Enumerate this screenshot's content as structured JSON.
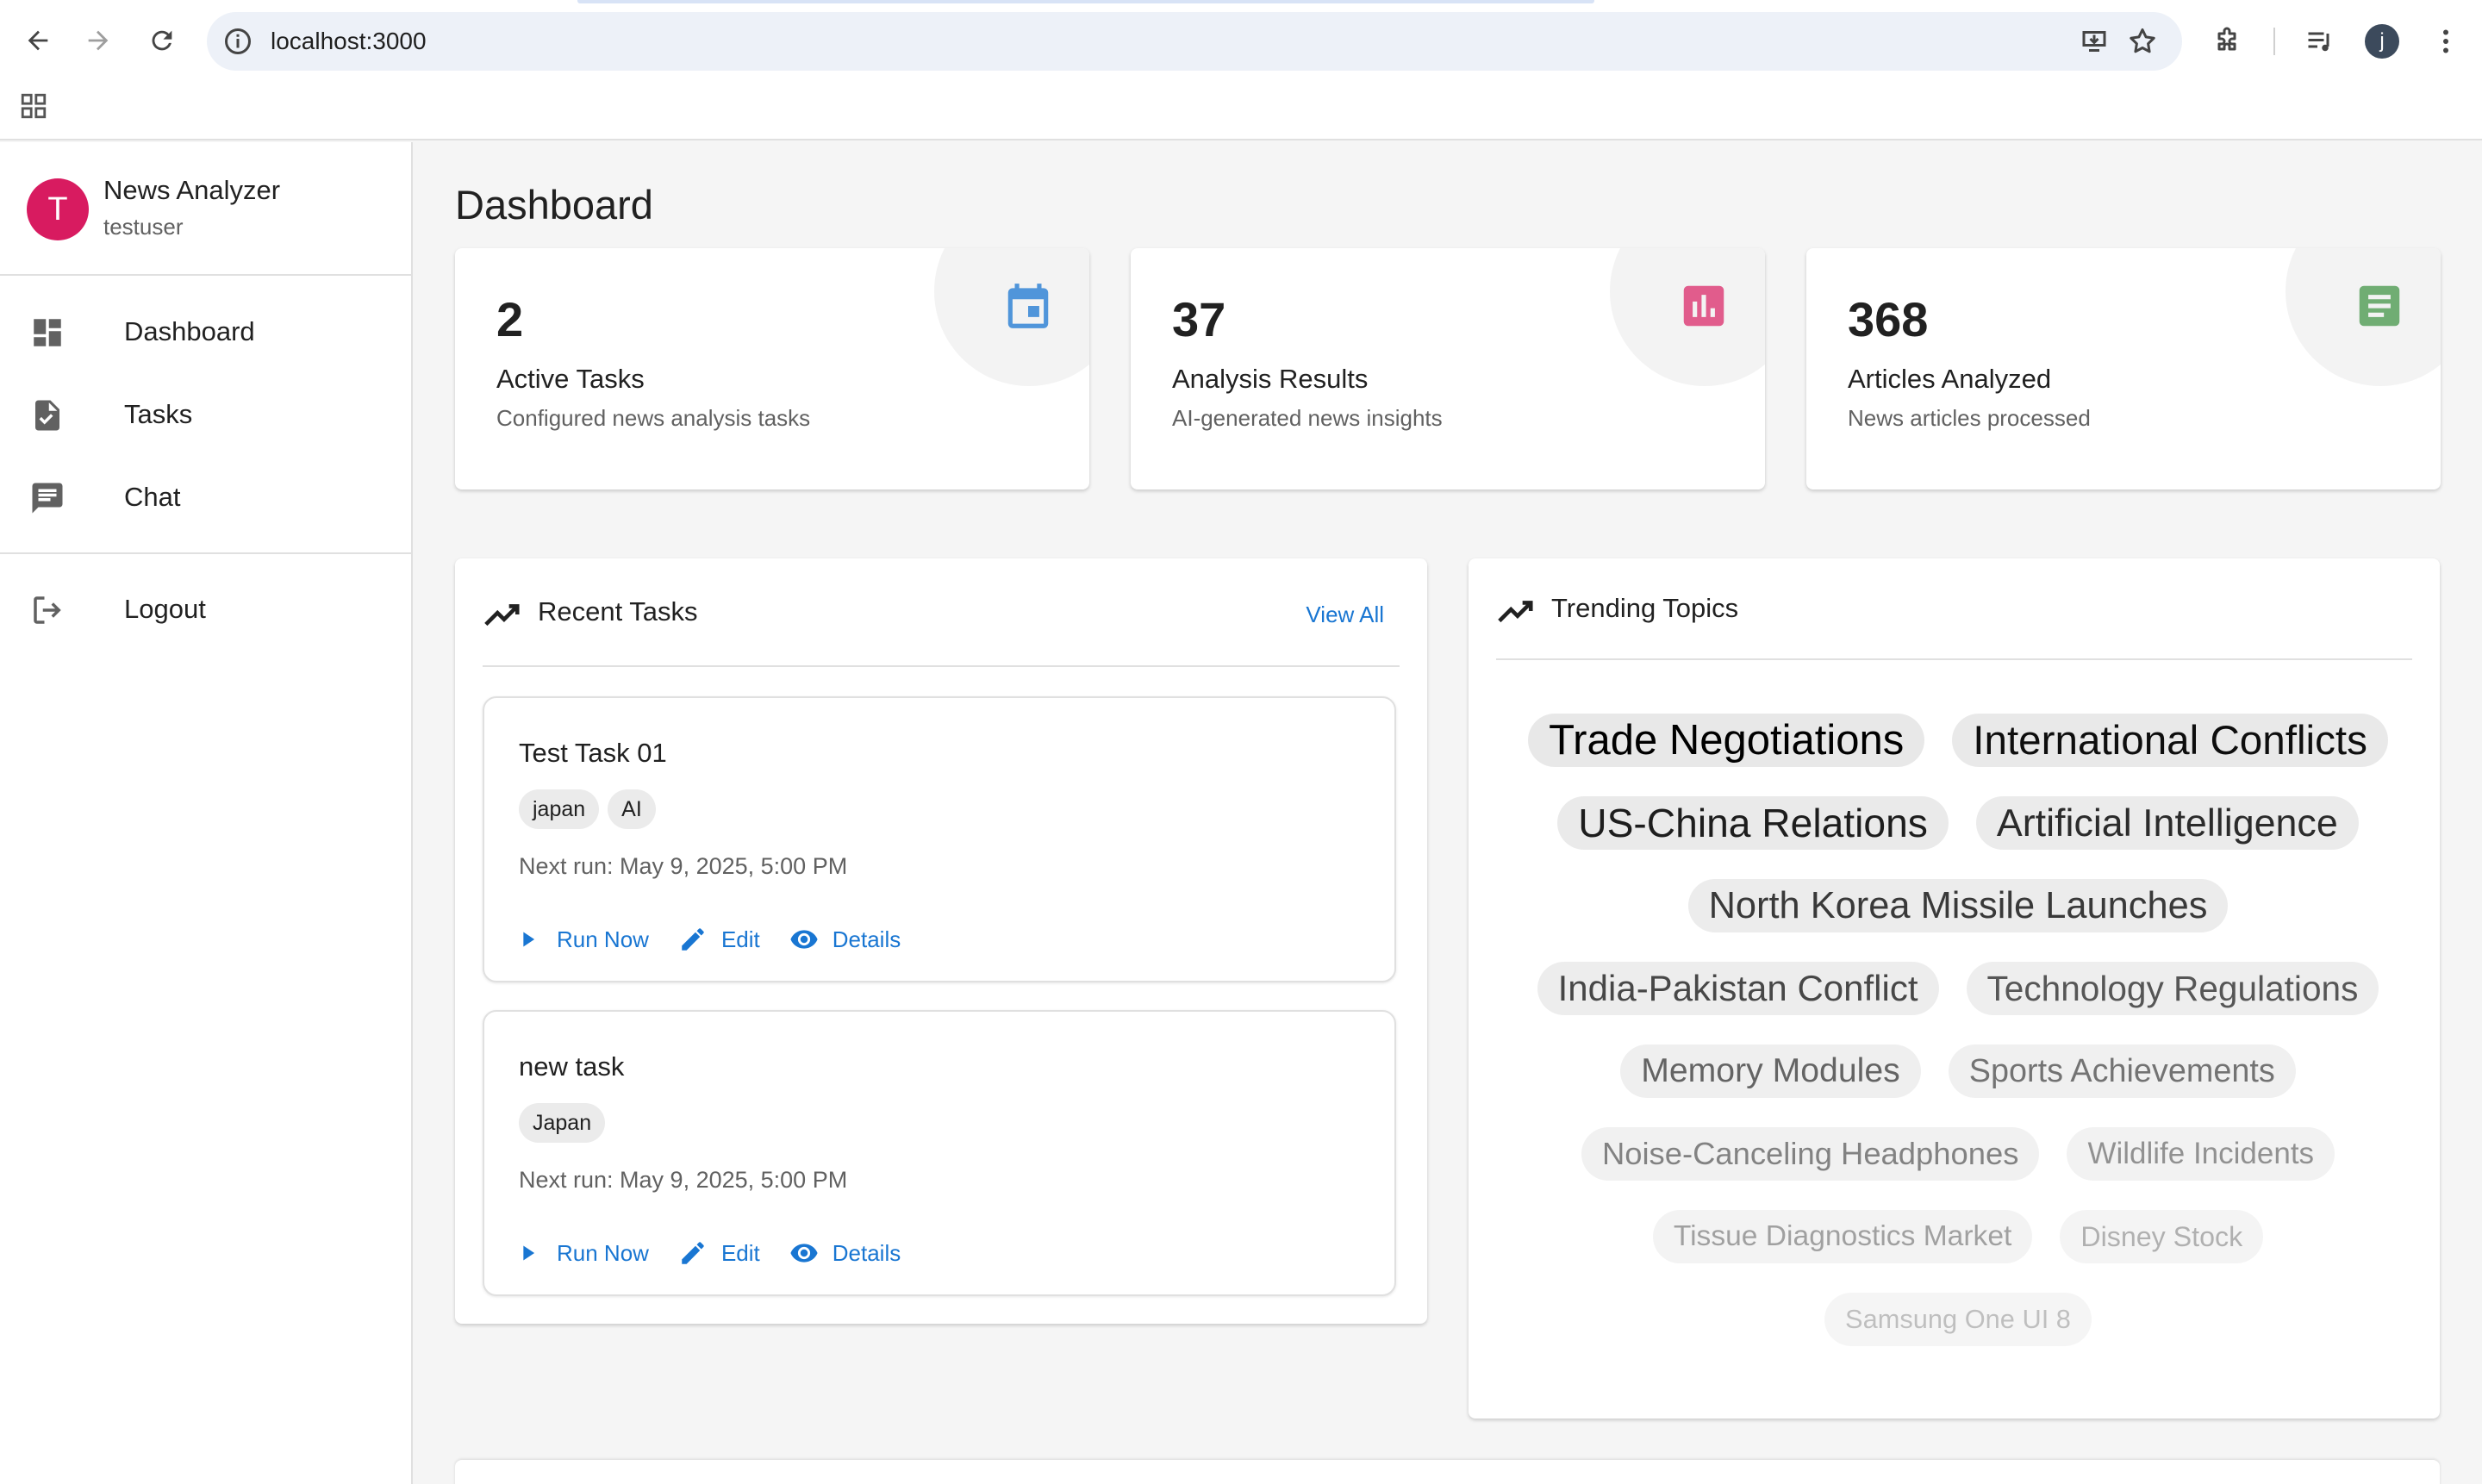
{
  "browser": {
    "url": "localhost:3000",
    "profile_initial": "j"
  },
  "sidebar": {
    "avatar_initial": "T",
    "app_name": "News Analyzer",
    "username": "testuser",
    "items": [
      {
        "label": "Dashboard",
        "icon": "dashboard-icon"
      },
      {
        "label": "Tasks",
        "icon": "task-icon"
      },
      {
        "label": "Chat",
        "icon": "chat-icon"
      }
    ],
    "logout_label": "Logout"
  },
  "main": {
    "title": "Dashboard",
    "stats": [
      {
        "value": "2",
        "label": "Active Tasks",
        "description": "Configured news analysis tasks",
        "icon": "calendar-icon",
        "color": "#1976d2"
      },
      {
        "value": "37",
        "label": "Analysis Results",
        "description": "AI-generated news insights",
        "icon": "bar-chart-icon",
        "color": "#d81b60"
      },
      {
        "value": "368",
        "label": "Articles Analyzed",
        "description": "News articles processed",
        "icon": "article-icon",
        "color": "#388e3c"
      }
    ],
    "recent_tasks": {
      "title": "Recent Tasks",
      "view_all": "View All",
      "tasks": [
        {
          "name": "Test Task 01",
          "tags": [
            "japan",
            "AI"
          ],
          "next_run": "Next run: May 9, 2025, 5:00 PM"
        },
        {
          "name": "new task",
          "tags": [
            "Japan"
          ],
          "next_run": "Next run: May 9, 2025, 5:00 PM"
        }
      ],
      "actions": {
        "run": "Run Now",
        "edit": "Edit",
        "details": "Details"
      }
    },
    "trending": {
      "title": "Trending Topics",
      "topics": [
        "Trade Negotiations",
        "International Conflicts",
        "US-China Relations",
        "Artificial Intelligence",
        "North Korea Missile Launches",
        "India-Pakistan Conflict",
        "Technology Regulations",
        "Memory Modules",
        "Sports Achievements",
        "Noise-Canceling Headphones",
        "Wildlife Incidents",
        "Tissue Diagnostics Market",
        "Disney Stock",
        "Samsung One UI 8"
      ]
    }
  },
  "colors": {
    "primary": "#1976d2",
    "accent_pink": "#d81b60",
    "green": "#388e3c",
    "background": "#f5f5f5"
  }
}
